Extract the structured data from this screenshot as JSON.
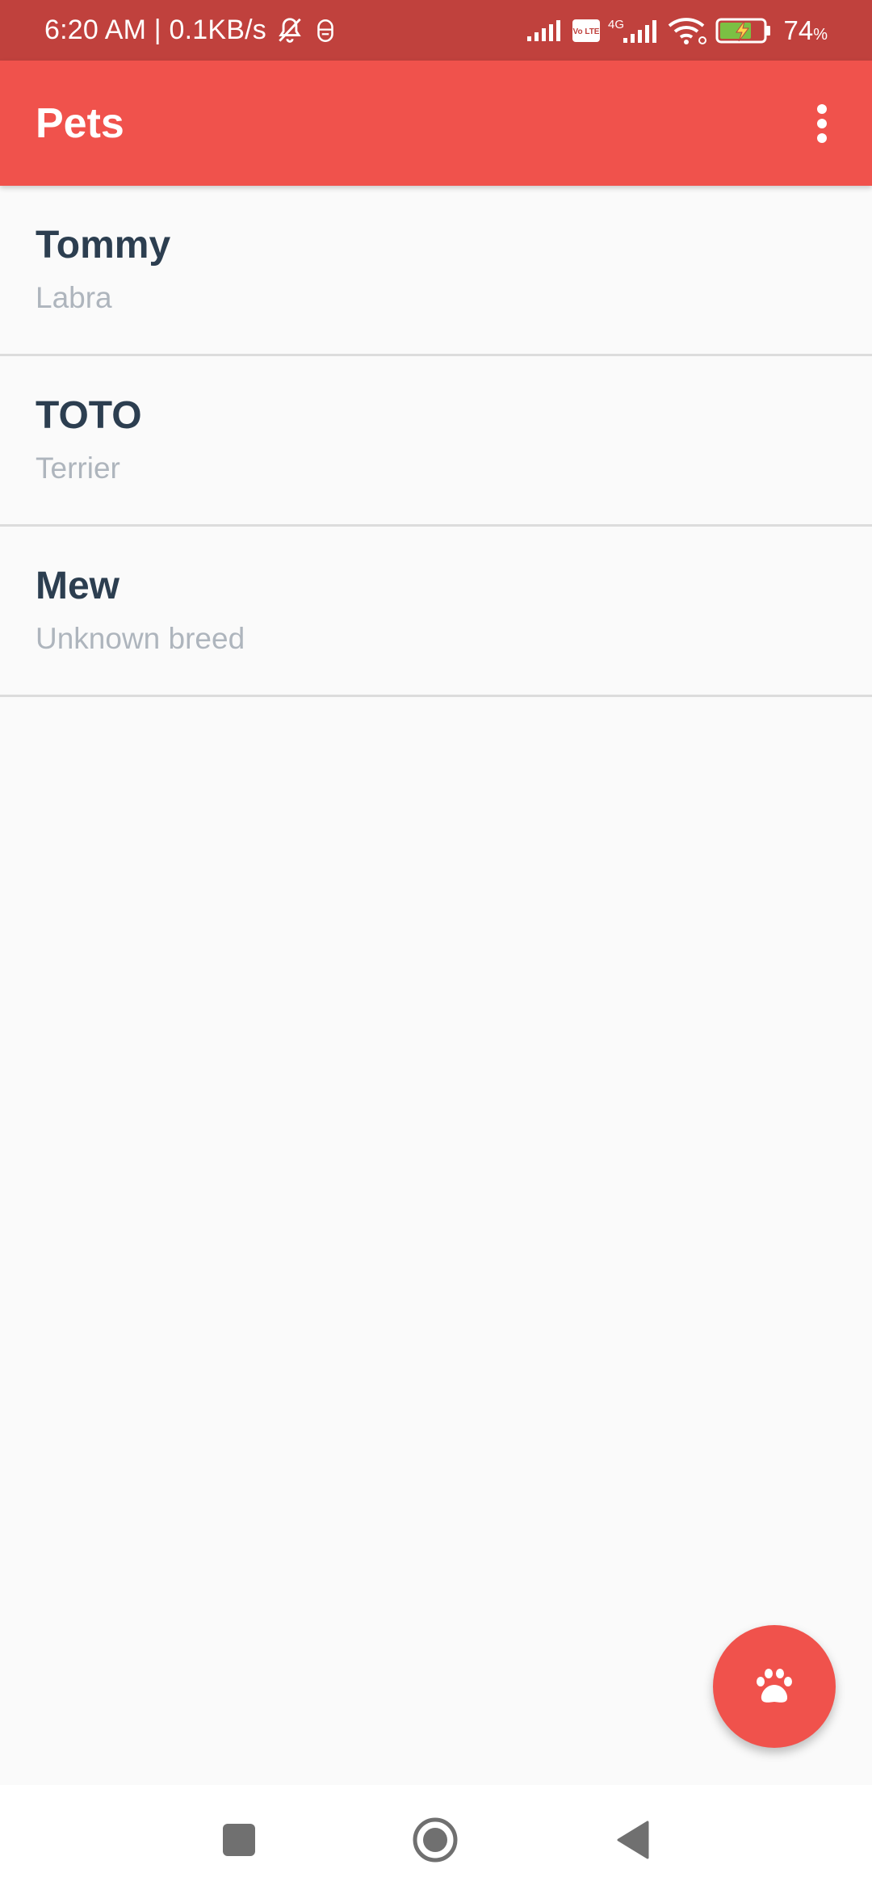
{
  "status_bar": {
    "time_speed": "6:20 AM | 0.1KB/s",
    "volte_label": "Vo LTE",
    "network_label": "4G",
    "battery_value": "74",
    "battery_unit": "%"
  },
  "app_bar": {
    "title": "Pets"
  },
  "pets": [
    {
      "name": "Tommy",
      "breed": "Labra"
    },
    {
      "name": "TOTO",
      "breed": "Terrier"
    },
    {
      "name": "Mew",
      "breed": "Unknown breed"
    }
  ],
  "icons": {
    "menu": "more-vert-icon",
    "fab": "paw-icon",
    "nav_recent": "square-icon",
    "nav_home": "circle-icon",
    "nav_back": "triangle-back-icon"
  },
  "colors": {
    "primary": "#f0524c",
    "status_bar": "#c0413d",
    "name_text": "#2c3e50",
    "breed_text": "#aeb5bd"
  }
}
